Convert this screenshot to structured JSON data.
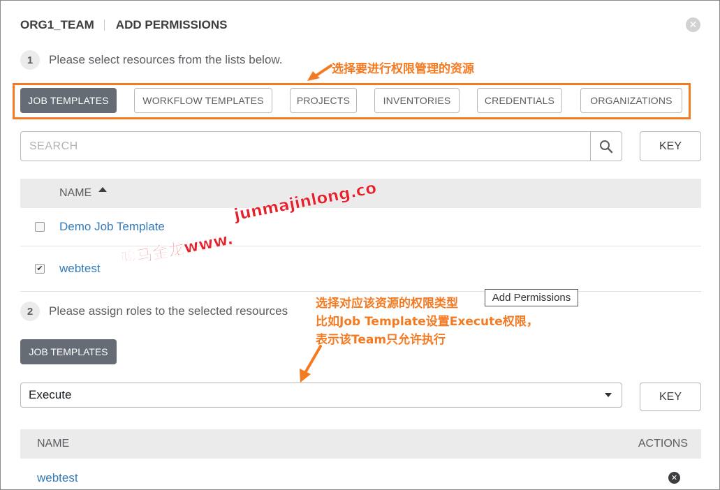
{
  "header": {
    "team": "ORG1_TEAM",
    "title": "ADD PERMISSIONS"
  },
  "step1": {
    "number": "1",
    "text": "Please select resources from the lists below."
  },
  "resource_tabs": [
    "JOB TEMPLATES",
    "WORKFLOW TEMPLATES",
    "PROJECTS",
    "INVENTORIES",
    "CREDENTIALS",
    "ORGANIZATIONS"
  ],
  "search": {
    "placeholder": "SEARCH",
    "key_label": "KEY"
  },
  "resource_table": {
    "header": "NAME",
    "rows": [
      {
        "name": "Demo Job Template",
        "checked": false
      },
      {
        "name": "webtest",
        "checked": true
      }
    ]
  },
  "tooltip": "Add Permissions",
  "step2": {
    "number": "2",
    "text": "Please assign roles to the selected resources"
  },
  "role_tab": "JOB TEMPLATES",
  "role_select": {
    "value": "Execute",
    "key_label": "KEY"
  },
  "selected_table": {
    "headers": {
      "name": "NAME",
      "actions": "ACTIONS"
    },
    "rows": [
      {
        "name": "webtest"
      }
    ]
  },
  "annotations": {
    "top": "选择要进行权限管理的资源",
    "middle_line1": "选择对应该资源的权限类型",
    "middle_line2": "比如Job Template设置Execute权限，",
    "middle_line3": "表示该Team只允许执行"
  },
  "watermark": {
    "line1": "junmajinlong.com",
    "line2": "骏马金龙www."
  },
  "colors": {
    "accent": "#f47a22",
    "active_tab": "#666c75",
    "link": "#337ab7",
    "watermark": "#e8202a"
  }
}
